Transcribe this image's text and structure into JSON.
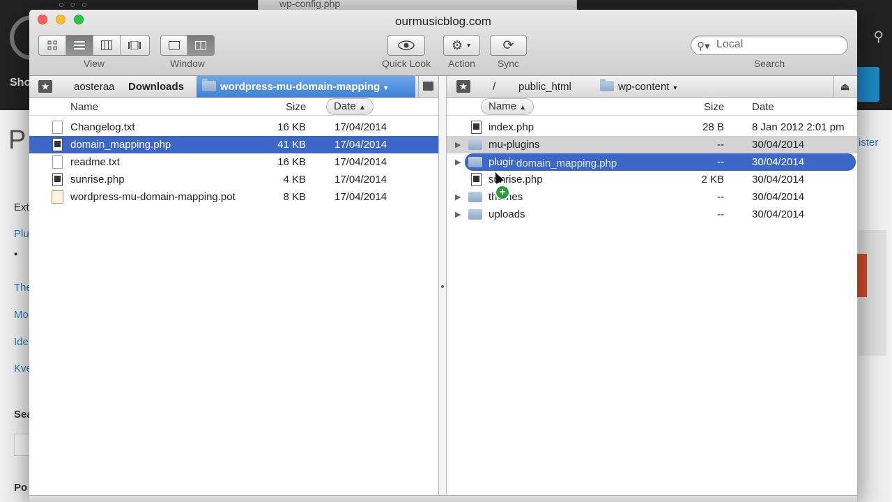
{
  "background": {
    "ghost_tab": "wp-config.php",
    "shop": "Sho",
    "page_title_fragment": "P",
    "left_links": [
      "Ext",
      "Plu",
      "The",
      "Mo",
      "Ide",
      "Kve",
      "Sea",
      "Po"
    ],
    "register_fragment": "ister"
  },
  "window": {
    "title": "ourmusicblog.com"
  },
  "toolbar": {
    "view_label": "View",
    "window_label": "Window",
    "quicklook_label": "Quick Look",
    "action_label": "Action",
    "sync_label": "Sync",
    "search_label": "Search",
    "search_value": "Local"
  },
  "left_pane": {
    "breadcrumbs": [
      "aosteraa",
      "Downloads",
      "wordpress-mu-domain-mapping"
    ],
    "columns": {
      "name": "Name",
      "size": "Size",
      "date": "Date"
    },
    "rows": [
      {
        "name": "Changelog.txt",
        "size": "16 KB",
        "date": "17/04/2014"
      },
      {
        "name": "domain_mapping.php",
        "size": "41 KB",
        "date": "17/04/2014"
      },
      {
        "name": "readme.txt",
        "size": "16 KB",
        "date": "17/04/2014"
      },
      {
        "name": "sunrise.php",
        "size": "4 KB",
        "date": "17/04/2014"
      },
      {
        "name": "wordpress-mu-domain-mapping.pot",
        "size": "8 KB",
        "date": "17/04/2014"
      }
    ]
  },
  "right_pane": {
    "breadcrumbs": [
      "/",
      "public_html",
      "wp-content"
    ],
    "columns": {
      "name": "Name",
      "size": "Size",
      "date": "Date"
    },
    "rows": [
      {
        "name": "index.php",
        "size": "28 B",
        "date": "8 Jan 2012 2:01 pm"
      },
      {
        "name": "mu-plugins",
        "size": "--",
        "date": "30/04/2014"
      },
      {
        "name": "plugins",
        "size": "--",
        "date": "30/04/2014"
      },
      {
        "name": "sunrise.php",
        "size": "2 KB",
        "date": "30/04/2014"
      },
      {
        "name": "themes",
        "size": "--",
        "date": "30/04/2014"
      },
      {
        "name": "uploads",
        "size": "--",
        "date": "30/04/2014"
      }
    ]
  },
  "drag": {
    "filename": "domain_mapping.php",
    "plus": "+"
  },
  "colors": {
    "selection": "#3d67c6",
    "breadcrumb_selected": "#4f8fdf",
    "add_badge": "#2e9b3a"
  }
}
